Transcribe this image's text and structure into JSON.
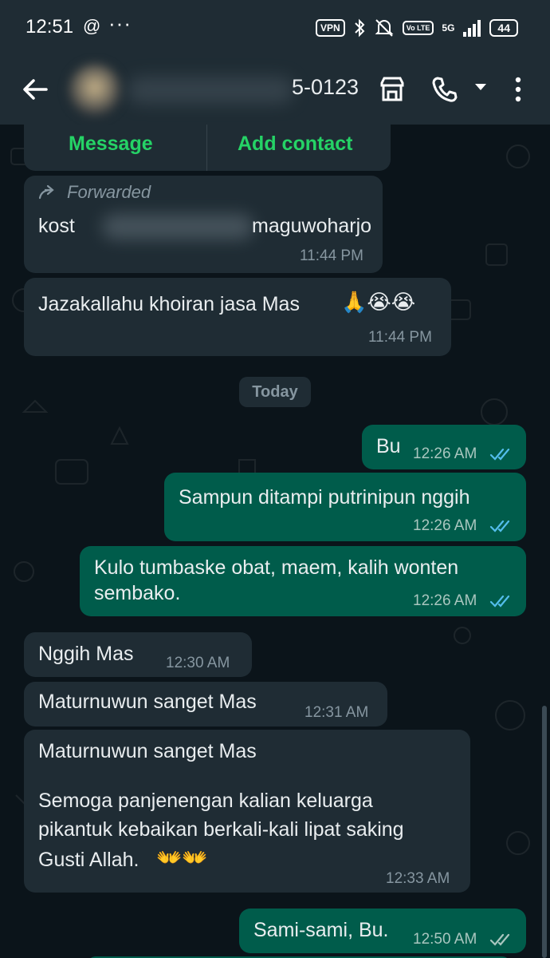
{
  "status_bar": {
    "time": "12:51",
    "app_glyph": "@",
    "more": "···",
    "vpn": "VPN",
    "volte": "Vo LTE",
    "network": "5G",
    "battery": "44"
  },
  "header": {
    "contact_tail": "5-0123",
    "icons": [
      "back-arrow-icon",
      "store-icon",
      "phone-icon",
      "chevron-down-icon",
      "more-vert-icon"
    ]
  },
  "actions": {
    "message": "Message",
    "add_contact": "Add contact"
  },
  "messages": [
    {
      "dir": "in",
      "forwarded": "Forwarded",
      "text_start": "kost",
      "text_end": "maguwoharjo",
      "time": "11:44 PM"
    },
    {
      "dir": "in",
      "text": "Jazakallahu khoiran jasa Mas",
      "emoji": "🙏😭😭",
      "time": "11:44 PM"
    },
    {
      "dir": "out",
      "text": "Bu",
      "time": "12:26 AM"
    },
    {
      "dir": "out",
      "text": "Sampun ditampi putrinipun nggih",
      "time": "12:26 AM"
    },
    {
      "dir": "out",
      "text_line1": "Kulo tumbaske obat, maem, kalih wonten",
      "text_line2": "sembako.",
      "time": "12:26 AM"
    },
    {
      "dir": "in",
      "text": "Nggih Mas",
      "time": "12:30 AM"
    },
    {
      "dir": "in",
      "text": "Maturnuwun sanget Mas",
      "time": "12:31 AM"
    },
    {
      "dir": "in",
      "line1": "Maturnuwun sanget Mas",
      "line2": "Semoga panjenengan kalian keluarga",
      "line3": "pikantuk kebaikan berkali-kali lipat saking",
      "line4": "Gusti Allah.",
      "emoji": "👐👐",
      "time": "12:33 AM"
    },
    {
      "dir": "out",
      "text": "Sami-sami, Bu.",
      "time": "12:50 AM"
    }
  ],
  "date_chip": "Today",
  "colors": {
    "incoming": "#1f2c34",
    "outgoing": "#005c4b",
    "accent": "#25d366",
    "read_tick": "#53bdeb",
    "background": "#0b141a"
  }
}
